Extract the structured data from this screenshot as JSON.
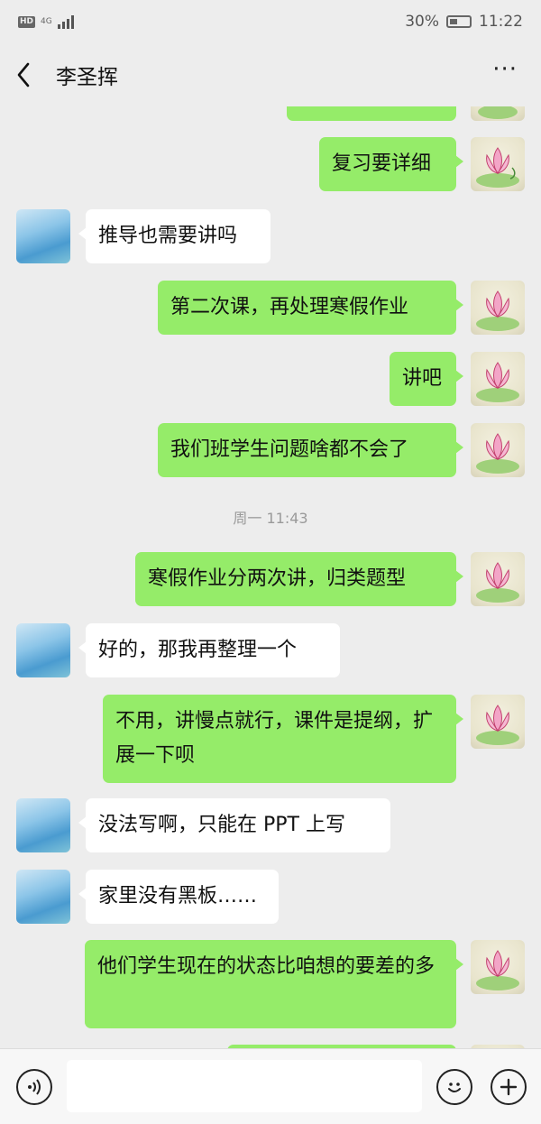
{
  "status_bar": {
    "hd": "HD",
    "net_type": "4G",
    "battery_pct": "30%",
    "time": "11:22"
  },
  "header": {
    "title": "李圣挥",
    "more": "···"
  },
  "messages": [
    {
      "from": "me",
      "text": ""
    },
    {
      "from": "me",
      "text": "复习要详细"
    },
    {
      "from": "them",
      "text": "推导也需要讲吗"
    },
    {
      "from": "me",
      "text": "第二次课，再处理寒假作业"
    },
    {
      "from": "me",
      "text": "讲吧"
    },
    {
      "from": "me",
      "text": "我们班学生问题啥都不会了"
    },
    {
      "from": "system",
      "text": "周一 11:43"
    },
    {
      "from": "me",
      "text": "寒假作业分两次讲，归类题型"
    },
    {
      "from": "them",
      "text": "好的，那我再整理一个"
    },
    {
      "from": "me",
      "text": "不用，讲慢点就行，课件是提纲，扩展一下呗"
    },
    {
      "from": "them",
      "text": "没法写啊，只能在 PPT 上写"
    },
    {
      "from": "them",
      "text": "家里没有黑板……"
    },
    {
      "from": "me",
      "text": "他们学生现在的状态比咱想的要差的多"
    },
    {
      "from": "me",
      "text": ""
    }
  ],
  "input_bar": {
    "voice_icon": "voice-icon",
    "emoji_icon": "emoji-icon",
    "plus_icon": "plus-icon"
  },
  "colors": {
    "my_bubble": "#95ec69",
    "their_bubble": "#ffffff",
    "background": "#ededed"
  }
}
